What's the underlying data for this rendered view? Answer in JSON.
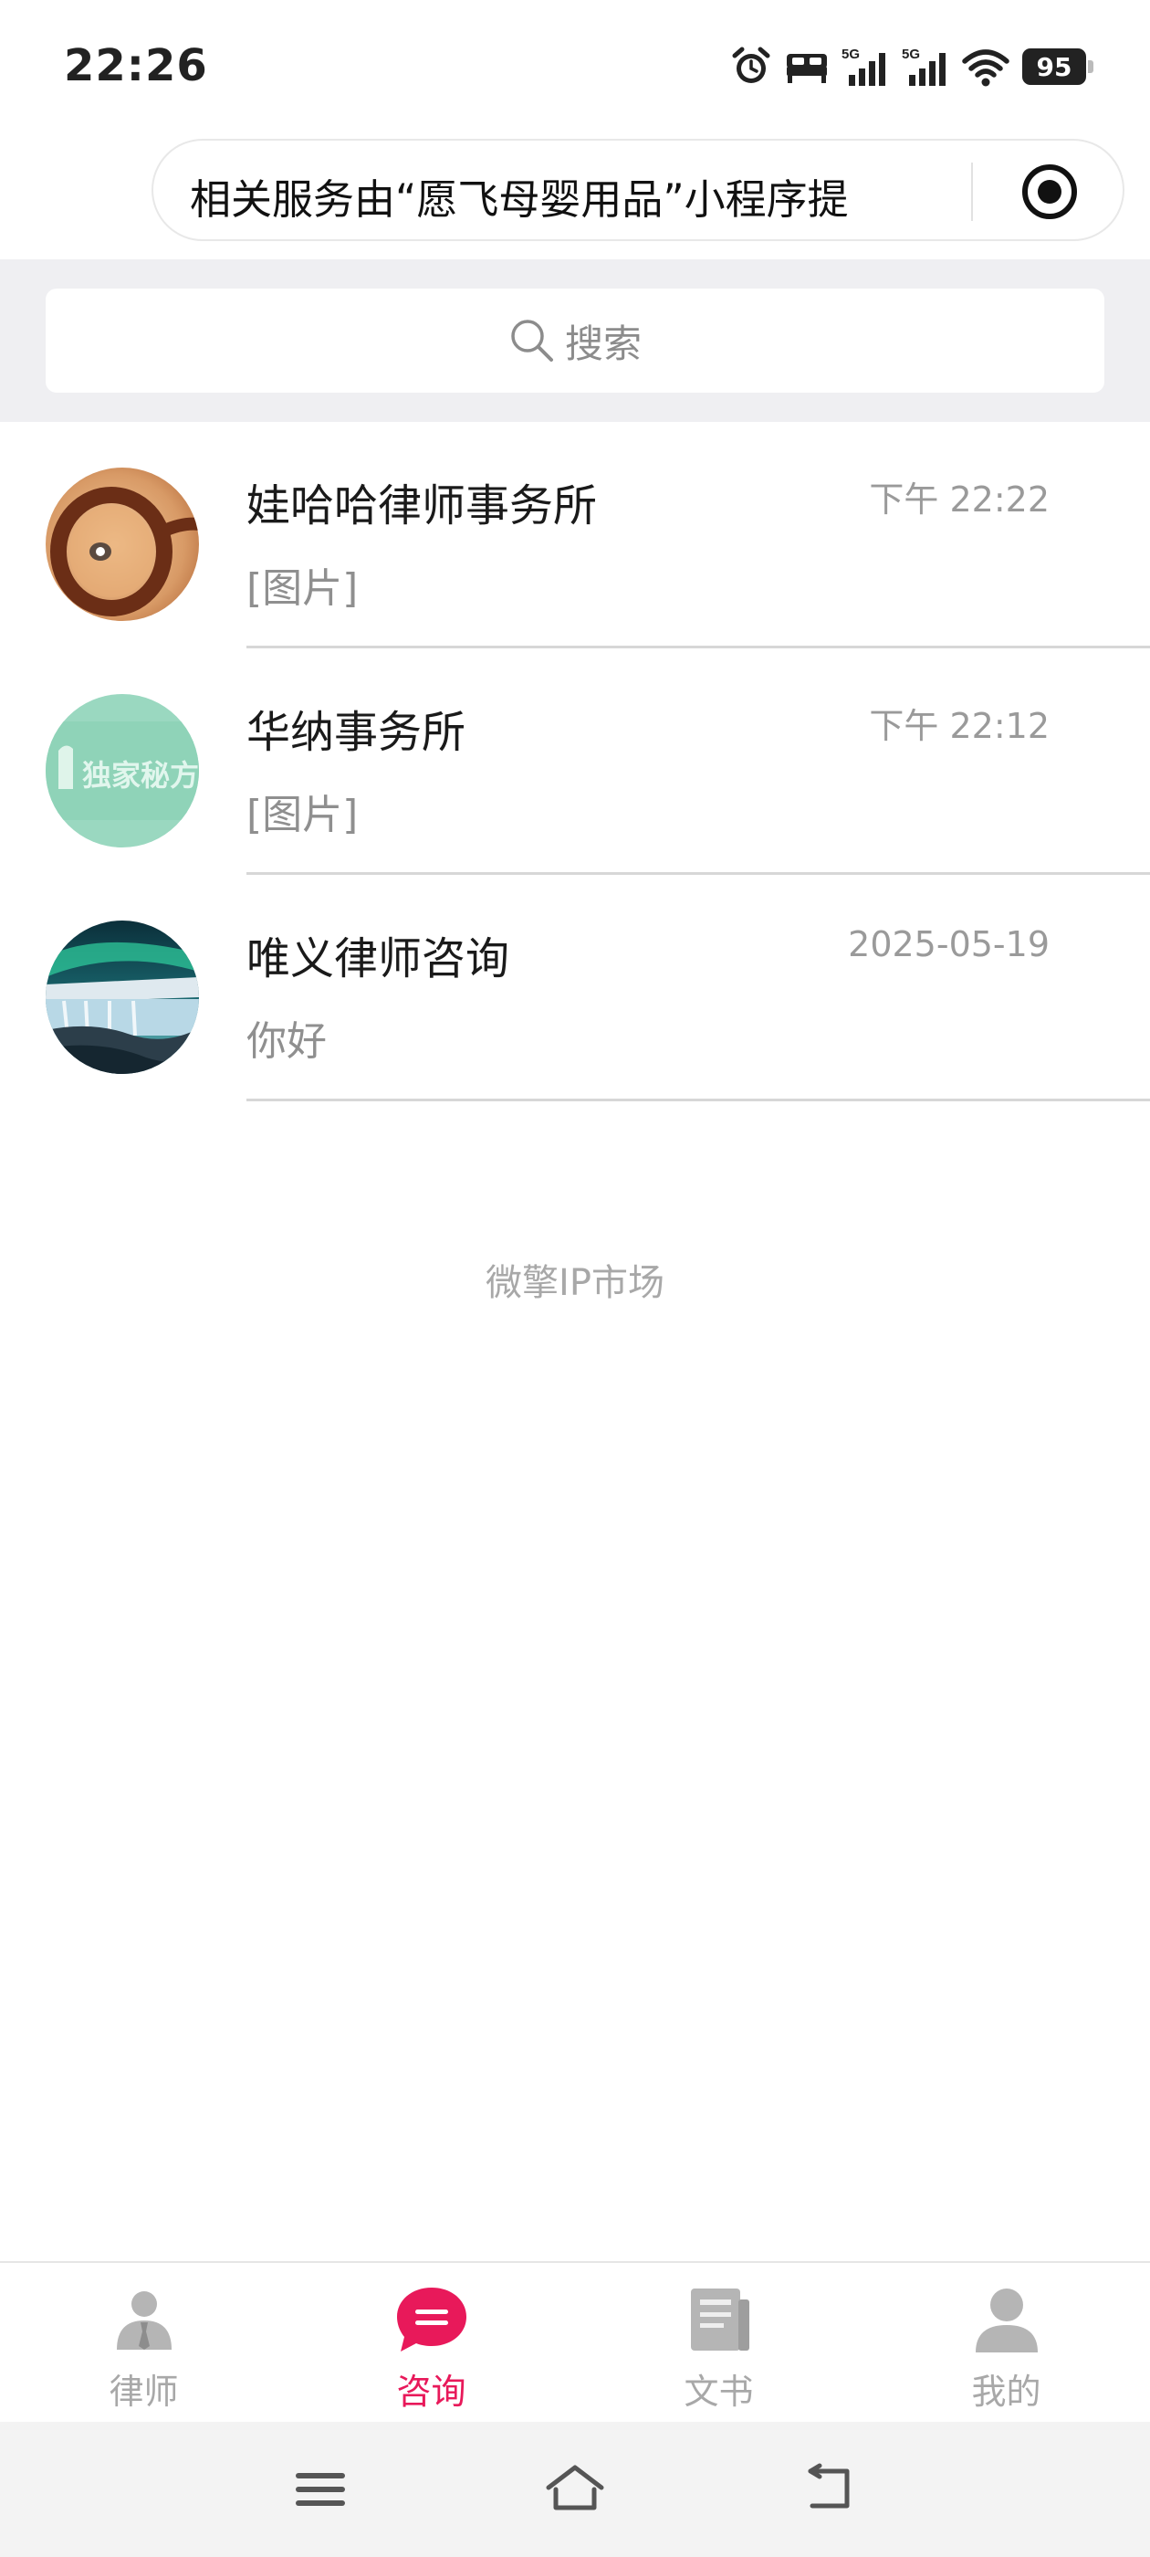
{
  "status_bar": {
    "time": "22:26",
    "battery": "95",
    "signal_labels": [
      "5G",
      "5G"
    ],
    "icons": [
      "alarm-icon",
      "bed-icon",
      "signal-5g-icon",
      "signal-5g-icon",
      "wifi-icon",
      "battery-icon"
    ]
  },
  "capsule": {
    "text": "相关服务由“愿飞母婴用品”小程序提",
    "icon": "target-icon"
  },
  "search": {
    "placeholder": "搜索",
    "icon": "search-icon"
  },
  "chats": [
    {
      "name": "娃哈哈律师事务所",
      "time": "下午 22:22",
      "message": "[图片]",
      "avatar": "glasses-avatar"
    },
    {
      "name": "华纳事务所",
      "time": "下午 22:12",
      "message": "[图片]",
      "avatar": "green-badge-avatar",
      "avatar_text": "独家秘方"
    },
    {
      "name": "唯义律师咨询",
      "time": "2025-05-19",
      "message": "你好",
      "avatar": "waterfall-aurora-avatar"
    }
  ],
  "footer": {
    "text": "微擎IP市场"
  },
  "tabs": [
    {
      "label": "律师",
      "icon": "lawyer-icon",
      "active": false
    },
    {
      "label": "咨询",
      "icon": "chat-bubble-icon",
      "active": true
    },
    {
      "label": "文书",
      "icon": "document-icon",
      "active": false
    },
    {
      "label": "我的",
      "icon": "user-icon",
      "active": false
    }
  ],
  "colors": {
    "accent": "#e8195a",
    "inactive": "#a8a8a8",
    "search_bg": "#efeff2"
  }
}
